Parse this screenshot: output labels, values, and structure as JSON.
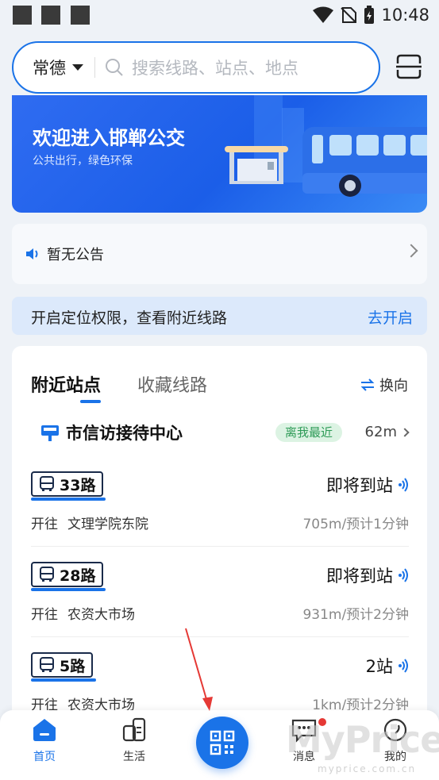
{
  "status_bar": {
    "time": "10:48"
  },
  "search": {
    "city": "常德",
    "placeholder": "搜索线路、站点、地点"
  },
  "banner": {
    "title": "欢迎进入邯郸公交",
    "subtitle": "公共出行，绿色环保"
  },
  "notice": {
    "text": "暂无公告"
  },
  "location": {
    "text": "开启定位权限，查看附近线路",
    "action": "去开启"
  },
  "panel": {
    "tabs": [
      {
        "label": "附近站点",
        "active": true
      },
      {
        "label": "收藏线路",
        "active": false
      }
    ],
    "switch_label": "换向",
    "station": {
      "name": "市信访接待中心",
      "badge": "离我最近",
      "distance": "62m"
    },
    "routes": [
      {
        "name": "33路",
        "status": "即将到站",
        "dest_prefix": "开往",
        "destination": "文理学院东院",
        "eta": "705m/预计1分钟"
      },
      {
        "name": "28路",
        "status": "即将到站",
        "dest_prefix": "开往",
        "destination": "农资大市场",
        "eta": "931m/预计2分钟"
      },
      {
        "name": "5路",
        "status": "2站",
        "dest_prefix": "开往",
        "destination": "农资大市场",
        "eta": "1km/预计2分钟"
      }
    ]
  },
  "tabbar": {
    "items": [
      {
        "label": "首页",
        "active": true
      },
      {
        "label": "生活",
        "active": false
      },
      {
        "label": "",
        "active": false
      },
      {
        "label": "消息",
        "active": false
      },
      {
        "label": "我的",
        "active": false
      }
    ]
  },
  "watermark": {
    "text": "MyPrice",
    "url": "myprice.com.cn"
  },
  "colors": {
    "accent": "#1a73e8",
    "badge_bg": "#dcf3e3",
    "badge_text": "#2e9b57",
    "red_dot": "#e53935"
  }
}
